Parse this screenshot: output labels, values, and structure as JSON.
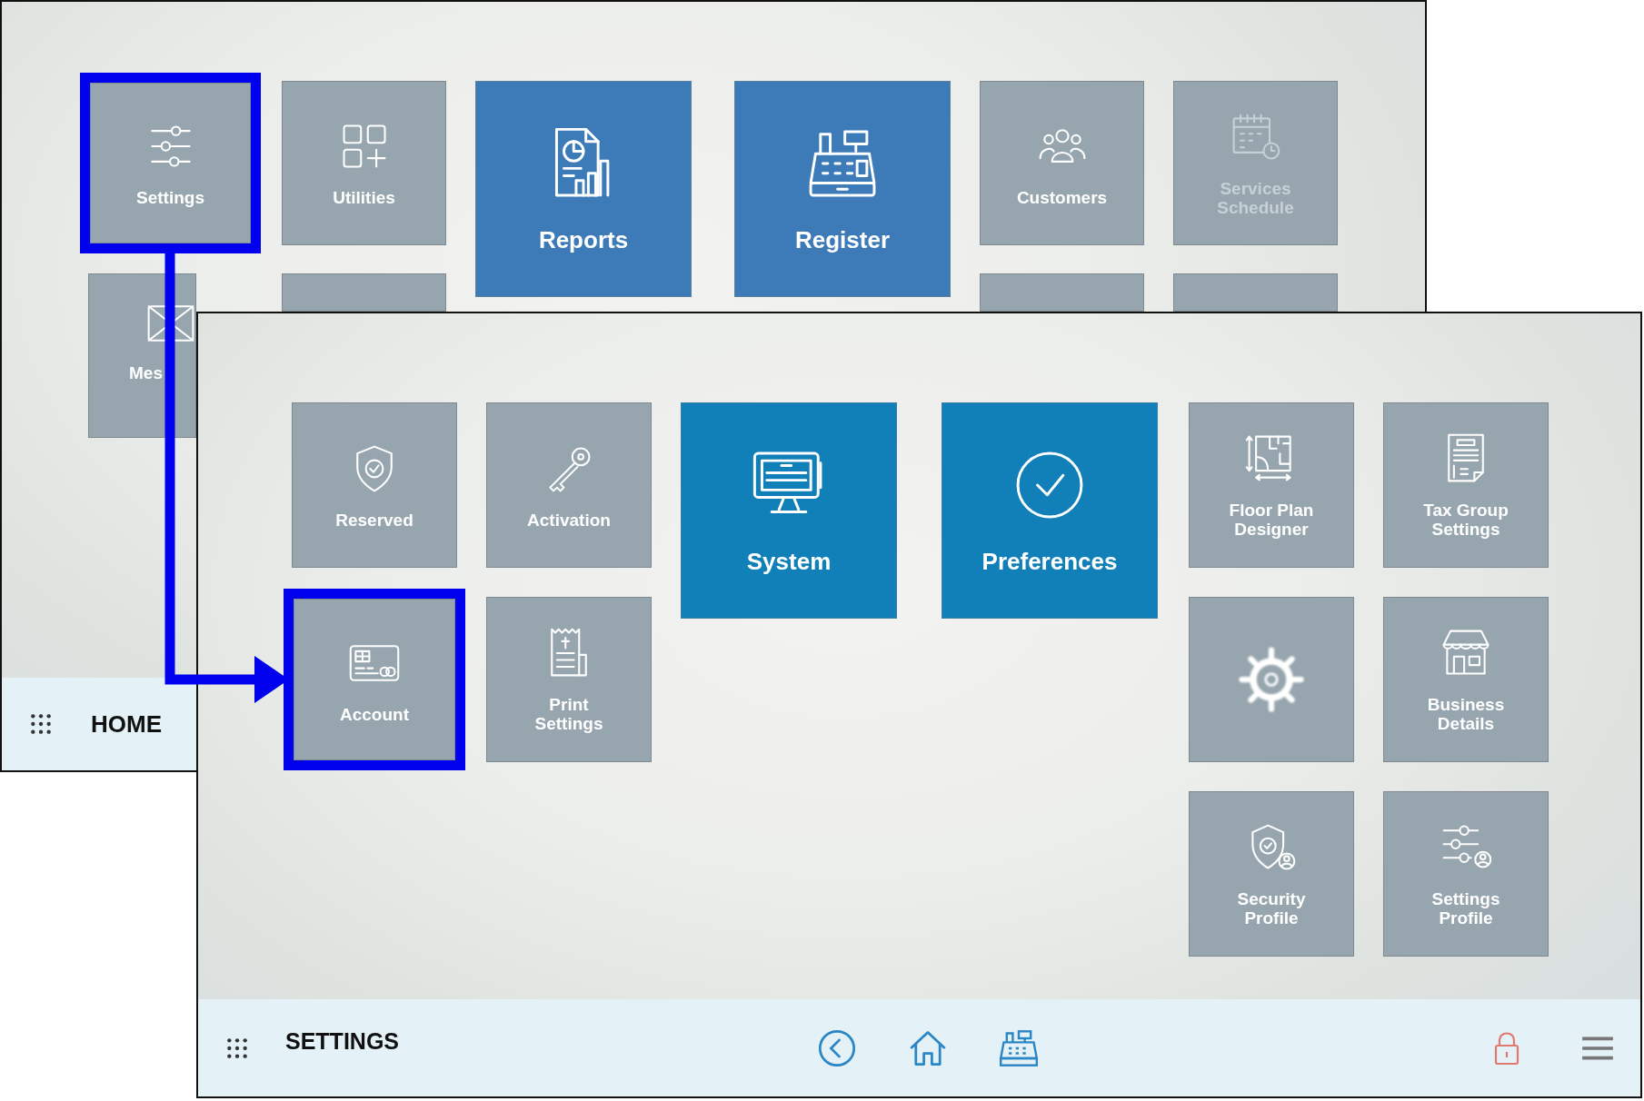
{
  "home_window": {
    "tiles": [
      {
        "label": "Settings",
        "kind": "small",
        "highlighted": true,
        "disabled": false
      },
      {
        "label": "Utilities",
        "kind": "small",
        "highlighted": false,
        "disabled": false
      },
      {
        "label": "Reports",
        "kind": "large",
        "highlighted": false,
        "disabled": false
      },
      {
        "label": "Register",
        "kind": "large",
        "highlighted": false,
        "disabled": false
      },
      {
        "label": "Customers",
        "kind": "small",
        "highlighted": false,
        "disabled": false
      },
      {
        "label": "Services Schedule",
        "kind": "small",
        "highlighted": false,
        "disabled": true
      },
      {
        "label": "Mes",
        "kind": "small",
        "highlighted": false,
        "disabled": false
      },
      {
        "kind": "small",
        "highlighted": false
      },
      {
        "kind": "small",
        "highlighted": false
      },
      {
        "kind": "small",
        "highlighted": false
      }
    ],
    "bottom_bar": {
      "title": "HOME"
    }
  },
  "settings_window": {
    "tiles": [
      {
        "label": "Reserved",
        "kind": "small",
        "highlighted": false
      },
      {
        "label": "Activation",
        "kind": "small",
        "highlighted": false
      },
      {
        "label": "System",
        "kind": "large",
        "highlighted": false
      },
      {
        "label": "Preferences",
        "kind": "large",
        "highlighted": false
      },
      {
        "label": "Floor Plan Designer",
        "kind": "small",
        "highlighted": false
      },
      {
        "label": "Tax Group Settings",
        "kind": "small",
        "highlighted": false
      },
      {
        "label": "Account",
        "kind": "small",
        "highlighted": true
      },
      {
        "label": "Print Settings",
        "kind": "small",
        "highlighted": false
      },
      {
        "kind": "small",
        "highlighted": false
      },
      {
        "label": "Business Details",
        "kind": "small",
        "highlighted": false
      },
      {
        "label": "Security Profile",
        "kind": "small",
        "highlighted": false
      },
      {
        "label": "Settings Profile",
        "kind": "small",
        "highlighted": false
      }
    ],
    "bottom_bar": {
      "title": "SETTINGS"
    }
  }
}
